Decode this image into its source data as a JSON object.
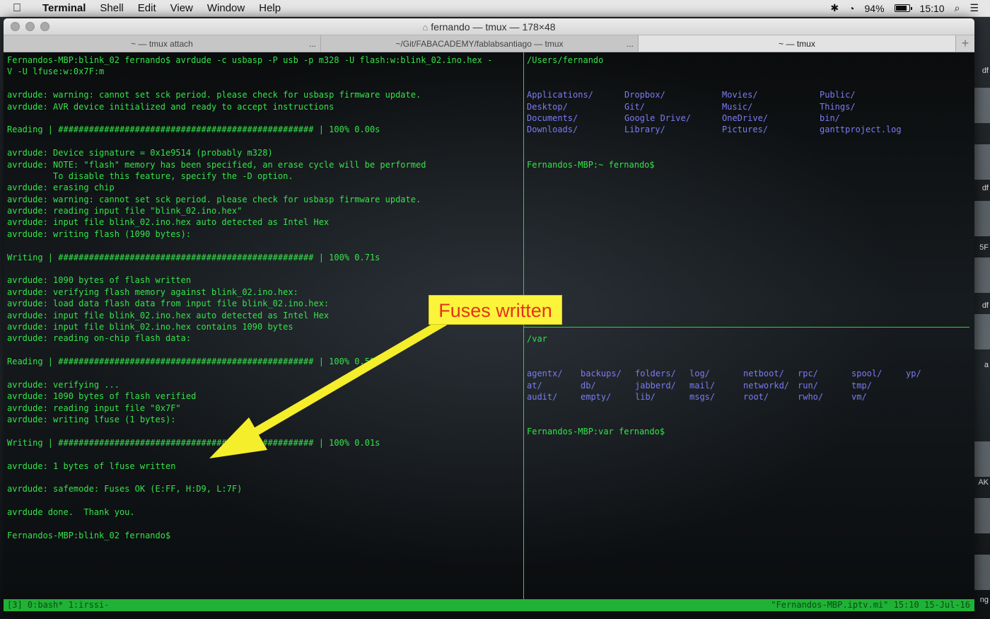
{
  "menubar": {
    "app": "Terminal",
    "items": [
      "Shell",
      "Edit",
      "View",
      "Window",
      "Help"
    ],
    "battery": "94%",
    "clock": "15:10"
  },
  "desktop_labels": [
    "df",
    "df",
    "5F",
    "df",
    "a",
    "AK",
    "ng"
  ],
  "window": {
    "title": "fernando — tmux — 178×48",
    "tabs": [
      {
        "label": "~ — tmux attach"
      },
      {
        "label": "~/Git/FABACADEMY/fablabsantiago — tmux"
      },
      {
        "label": "~ — tmux"
      }
    ],
    "tab_overflow": "...",
    "tab_plus": "+"
  },
  "left_pane": [
    "Fernandos-MBP:blink_02 fernando$ avrdude -c usbasp -P usb -p m328 -U flash:w:blink_02.ino.hex -",
    "V -U lfuse:w:0x7F:m",
    "",
    "avrdude: warning: cannot set sck period. please check for usbasp firmware update.",
    "avrdude: AVR device initialized and ready to accept instructions",
    "",
    "Reading | ################################################## | 100% 0.00s",
    "",
    "avrdude: Device signature = 0x1e9514 (probably m328)",
    "avrdude: NOTE: \"flash\" memory has been specified, an erase cycle will be performed",
    "         To disable this feature, specify the -D option.",
    "avrdude: erasing chip",
    "avrdude: warning: cannot set sck period. please check for usbasp firmware update.",
    "avrdude: reading input file \"blink_02.ino.hex\"",
    "avrdude: input file blink_02.ino.hex auto detected as Intel Hex",
    "avrdude: writing flash (1090 bytes):",
    "",
    "Writing | ################################################## | 100% 0.71s",
    "",
    "avrdude: 1090 bytes of flash written",
    "avrdude: verifying flash memory against blink_02.ino.hex:",
    "avrdude: load data flash data from input file blink_02.ino.hex:",
    "avrdude: input file blink_02.ino.hex auto detected as Intel Hex",
    "avrdude: input file blink_02.ino.hex contains 1090 bytes",
    "avrdude: reading on-chip flash data:",
    "",
    "Reading | ################################################## | 100% 0.59s",
    "",
    "avrdude: verifying ...",
    "avrdude: 1090 bytes of flash verified",
    "avrdude: reading input file \"0x7F\"",
    "avrdude: writing lfuse (1 bytes):",
    "",
    "Writing | ################################################## | 100% 0.01s",
    "",
    "avrdude: 1 bytes of lfuse written",
    "",
    "avrdude: safemode: Fuses OK (E:FF, H:D9, L:7F)",
    "",
    "avrdude done.  Thank you.",
    "",
    "Fernandos-MBP:blink_02 fernando$"
  ],
  "right_top": {
    "cwd": "/Users/fernando",
    "entries": [
      "Applications/",
      "Dropbox/",
      "Movies/",
      "Public/",
      "Desktop/",
      "Git/",
      "Music/",
      "Things/",
      "Documents/",
      "Google Drive/",
      "OneDrive/",
      "bin/",
      "Downloads/",
      "Library/",
      "Pictures/",
      "ganttproject.log"
    ],
    "prompt": "Fernandos-MBP:~ fernando$"
  },
  "right_bottom": {
    "cwd": "/var",
    "entries": [
      "agentx/",
      "backups/",
      "folders/",
      "log/",
      "netboot/",
      "rpc/",
      "spool/",
      "yp/",
      "at/",
      "db/",
      "jabberd/",
      "mail/",
      "networkd/",
      "run/",
      "tmp/",
      "",
      "audit/",
      "empty/",
      "lib/",
      "msgs/",
      "root/",
      "rwho/",
      "vm/",
      ""
    ],
    "highlight": "tmp",
    "prompt": "Fernandos-MBP:var fernando$"
  },
  "status_bar": {
    "left": "[3] 0:bash* 1:irssi-",
    "right": "\"Fernandos-MBP.iptv.mi\" 15:10 15-Jul-16"
  },
  "annotation": {
    "text": "Fuses written",
    "color": "#fbf43a",
    "text_color": "#e8321a"
  }
}
